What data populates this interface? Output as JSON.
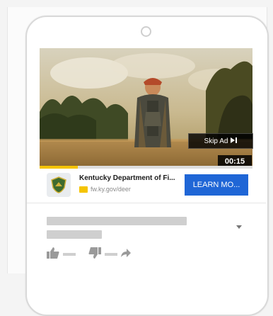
{
  "ad": {
    "skip_label": "Skip Ad",
    "skip_icon": "skip-next-icon",
    "timer": "00:15",
    "progress_fraction": 0.18,
    "progress_color": "#f5c400",
    "title": "Kentucky Department of Fi...",
    "url": "fw.ky.gov/deer",
    "cta_label": "LEARN MO...",
    "cta_color": "#1f66d6"
  },
  "icons": {
    "like": "thumbs-up-icon",
    "dislike": "thumbs-down-icon",
    "share": "share-arrow-icon",
    "expand": "chevron-down-icon"
  }
}
